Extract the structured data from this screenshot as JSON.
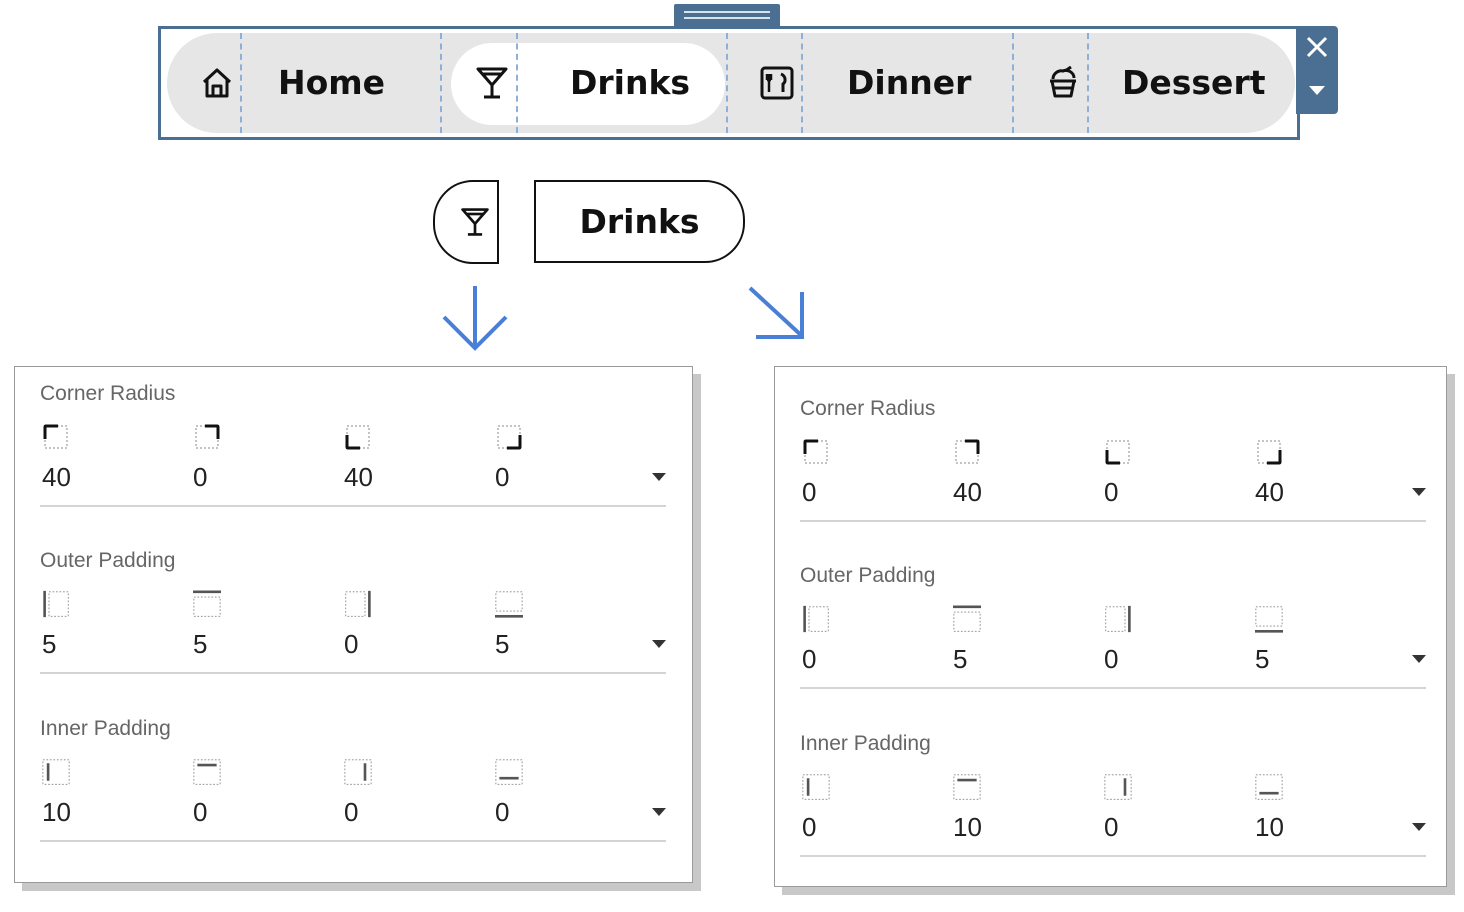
{
  "nav": {
    "items": [
      {
        "label": "Home",
        "icon": "home-icon"
      },
      {
        "label": "Drinks",
        "icon": "cocktail-glass-icon"
      },
      {
        "label": "Dinner",
        "icon": "fork-knife-icon"
      },
      {
        "label": "Dessert",
        "icon": "cupcake-icon"
      }
    ],
    "selected": "Drinks",
    "accent_color": "#4b6f93",
    "bar_color": "#e6e6e6",
    "guide_color": "#8fb0d6"
  },
  "preview": {
    "icon": "cocktail-glass-icon",
    "label": "Drinks"
  },
  "arrow_color": "#4a7fd8",
  "panels": {
    "left": {
      "corner_radius": {
        "title": "Corner Radius",
        "values": [
          "40",
          "0",
          "40",
          "0"
        ]
      },
      "outer_padding": {
        "title": "Outer Padding",
        "values": [
          "5",
          "5",
          "0",
          "5"
        ]
      },
      "inner_padding": {
        "title": "Inner Padding",
        "values": [
          "10",
          "0",
          "0",
          "0"
        ]
      }
    },
    "right": {
      "corner_radius": {
        "title": "Corner Radius",
        "values": [
          "0",
          "40",
          "0",
          "40"
        ]
      },
      "outer_padding": {
        "title": "Outer Padding",
        "values": [
          "0",
          "5",
          "0",
          "5"
        ]
      },
      "inner_padding": {
        "title": "Inner Padding",
        "values": [
          "0",
          "10",
          "0",
          "10"
        ]
      }
    }
  }
}
